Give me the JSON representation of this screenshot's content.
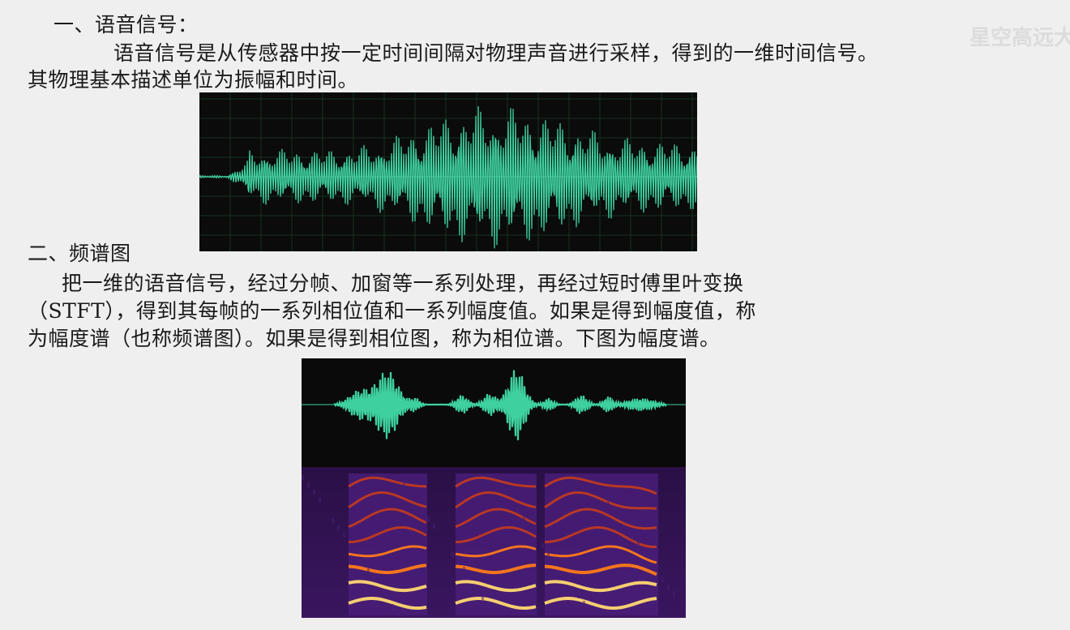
{
  "watermark": "星空高远大",
  "section1": {
    "heading": "一、语音信号：",
    "para_line1": "语音信号是从传感器中按一定时间间隔对物理声音进行采样，得到的一维时间信号。",
    "para_line2": "其物理基本描述单位为振幅和时间。"
  },
  "section2": {
    "heading": "二、频谱图",
    "para_line1": "把一维的语音信号，经过分帧、加窗等一系列处理，再经过短时傅里叶变换",
    "para_line2": "（STFT），得到其每帧的一系列相位值和一系列幅度值。如果是得到幅度值，称",
    "para_line3": "为幅度谱（也称频谱图）。如果是得到相位图，称为相位谱。下图为幅度谱。"
  },
  "figures": {
    "waveform": {
      "wave_color": "#3fd0a0",
      "background": "#0b0b0b"
    },
    "speech_wave": {
      "wave_color": "#3fd0a0",
      "background": "#0a0a0a"
    },
    "spectrogram": {
      "colormap": [
        "#1a0b30",
        "#4a1e7a",
        "#c03a20",
        "#ff7a18",
        "#ffd870"
      ]
    }
  }
}
